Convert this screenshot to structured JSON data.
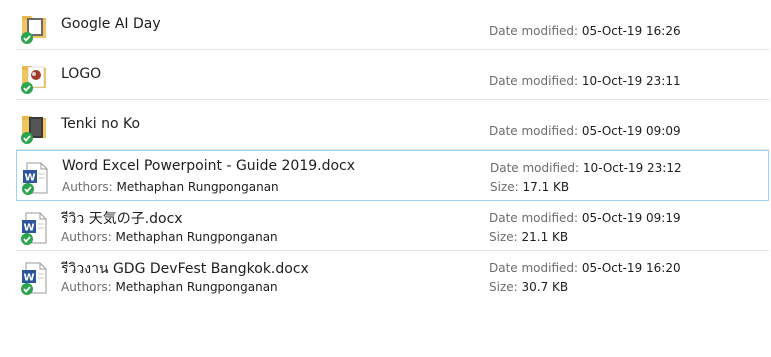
{
  "labels": {
    "date_modified": "Date modified:",
    "authors": "Authors:",
    "size": "Size:"
  },
  "items": [
    {
      "name": "Google AI Day",
      "date": "05-Oct-19 16:26",
      "kind": "folder-icon"
    },
    {
      "name": "LOGO",
      "date": "10-Oct-19 23:11",
      "kind": "folder-icon"
    },
    {
      "name": "Tenki no Ko",
      "date": "05-Oct-19 09:09",
      "kind": "folder-icon"
    },
    {
      "name": "Word Excel Powerpoint - Guide 2019.docx",
      "author": "Methaphan Rungponganan",
      "date": "10-Oct-19 23:12",
      "size": "17.1 KB",
      "kind": "word-doc-icon"
    },
    {
      "name": "รีวิว 天気の子.docx",
      "author": "Methaphan Rungponganan",
      "date": "05-Oct-19 09:19",
      "size": "21.1 KB",
      "kind": "word-doc-icon"
    },
    {
      "name": "รีวิวงาน GDG DevFest Bangkok.docx",
      "author": "Methaphan Rungponganan",
      "date": "05-Oct-19 16:20",
      "size": "30.7 KB",
      "kind": "word-doc-icon"
    }
  ],
  "colors": {
    "selection_border": "#99d1ff",
    "sync_check": "#2da44e",
    "word_blue": "#2b579a",
    "folder_yellow": "#f0c75e"
  }
}
